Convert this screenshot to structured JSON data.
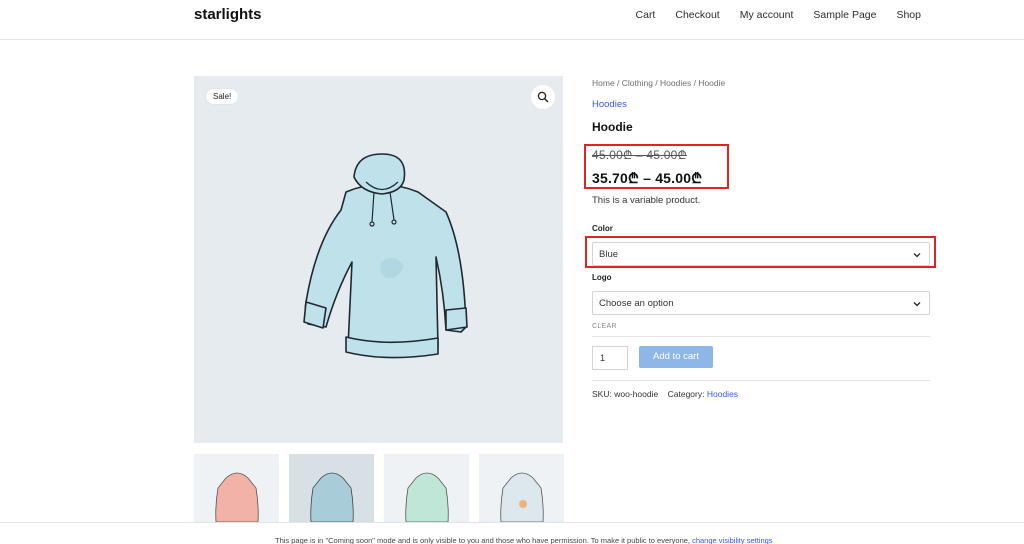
{
  "site": {
    "title": "starlights"
  },
  "nav": [
    "Cart",
    "Checkout",
    "My account",
    "Sample Page",
    "Shop"
  ],
  "gallery": {
    "sale_badge": "Sale!",
    "zoom_icon": "search-icon"
  },
  "product": {
    "breadcrumb": "Home / Clothing / Hoodies / Hoodie",
    "category_link": "Hoodies",
    "title": "Hoodie",
    "price_old": "45.00₾ – 45.00₾",
    "price_new": "35.70₾ – 45.00₾",
    "description": "This is a variable product."
  },
  "variations": {
    "color_label": "Color",
    "color_value": "Blue",
    "logo_label": "Logo",
    "logo_value": "Choose an option",
    "clear": "CLEAR"
  },
  "cart": {
    "quantity": "1",
    "add_to_cart": "Add to cart"
  },
  "meta": {
    "sku_label": "SKU:",
    "sku_value": "woo-hoodie",
    "category_label": "Category:",
    "category_value": "Hoodies"
  },
  "footer": {
    "text": "This page is in \"Coming soon\" mode and is only visible to you and those who have permission. To make it public to everyone,",
    "link": "change visibility settings"
  },
  "colors": {
    "accent": "#3858e9",
    "highlight": "#e02424",
    "button": "#8fb6e9"
  }
}
